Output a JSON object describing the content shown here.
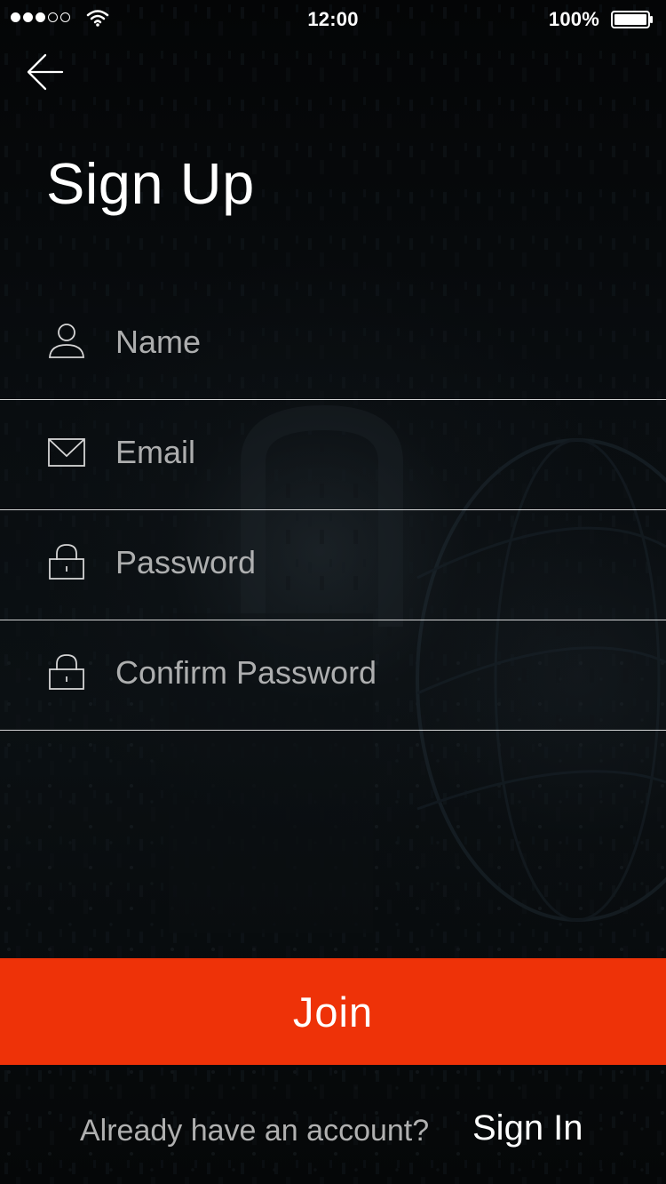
{
  "status_bar": {
    "time": "12:00",
    "battery_percent": "100%",
    "signal_strength": 3,
    "signal_max": 5
  },
  "navigation": {
    "back_icon": "arrow-left-icon"
  },
  "header": {
    "title": "Sign Up"
  },
  "form": {
    "fields": [
      {
        "placeholder": "Name",
        "value": "",
        "icon": "user-icon",
        "type": "text"
      },
      {
        "placeholder": "Email",
        "value": "",
        "icon": "envelope-icon",
        "type": "email"
      },
      {
        "placeholder": "Password",
        "value": "",
        "icon": "lock-icon",
        "type": "password"
      },
      {
        "placeholder": "Confirm Password",
        "value": "",
        "icon": "lock-icon",
        "type": "password"
      }
    ]
  },
  "actions": {
    "join_label": "Join"
  },
  "footer": {
    "question": "Already have an account?",
    "signin_label": "Sign In"
  },
  "colors": {
    "accent": "#ee3208",
    "background": "#050607",
    "text": "#ffffff",
    "muted_text": "#d6d6d6"
  }
}
